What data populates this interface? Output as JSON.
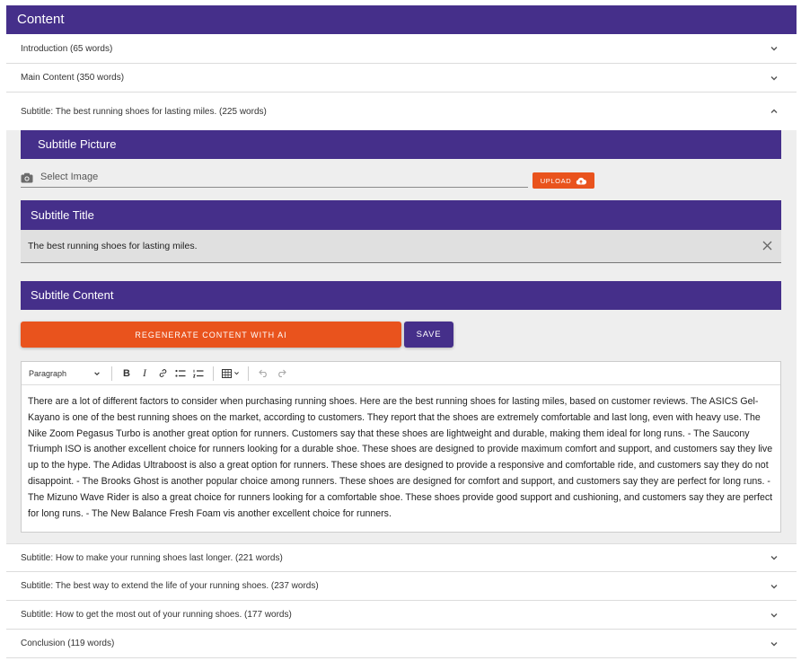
{
  "header": {
    "title": "Content"
  },
  "sections": {
    "introduction": "Introduction  (65 words)",
    "main_content": "Main Content  (350 words)",
    "subtitle_1": "Subtitle: The best running shoes for lasting miles.  (225 words)",
    "subtitle_2": "Subtitle: How to make your running shoes last longer.  (221 words)",
    "subtitle_3": "Subtitle: The best way to extend the life of your running shoes.  (237 words)",
    "subtitle_4": "Subtitle: How to get the most out of your running shoes.  (177 words)",
    "conclusion": "Conclusion  (119 words)"
  },
  "subtitle_picture": {
    "heading": "Subtitle Picture",
    "select_label": "Select Image",
    "upload_label": "UPLOAD"
  },
  "subtitle_title": {
    "heading": "Subtitle Title",
    "value": "The best running shoes for lasting miles."
  },
  "subtitle_content": {
    "heading": "Subtitle Content",
    "regenerate_label": "REGENERATE CONTENT WITH AI",
    "save_label": "SAVE"
  },
  "editor": {
    "format_select": "Paragraph",
    "body": "There are a lot of different factors to consider when purchasing running shoes. Here are the best running shoes for lasting miles, based on customer reviews. The ASICS Gel-Kayano is one of the best running shoes on the market, according to customers. They report that the shoes are extremely comfortable and last long, even with heavy use. The Nike Zoom Pegasus Turbo is another great option for runners. Customers say that these shoes are lightweight and durable, making them ideal for long runs. - The Saucony Triumph ISO is another excellent choice for runners looking for a durable shoe. These shoes are designed to provide maximum comfort and support, and customers say they live up to the hype. The Adidas Ultraboost is also a great option for runners. These shoes are designed to provide a responsive and comfortable ride, and customers say they do not disappoint. - The Brooks Ghost is another popular choice among runners. These shoes are designed for comfort and support, and customers say they are perfect for long runs. - The Mizuno Wave Rider is also a great choice for runners looking for a comfortable shoe. These shoes provide good support and cushioning, and customers say they are perfect for long runs. - The New Balance Fresh Foam vis another excellent choice for runners."
  },
  "icons": {
    "chevron_down": "chevron-down-icon",
    "chevron_up": "chevron-up-icon",
    "camera": "camera-icon",
    "cloud_upload": "cloud-upload-icon",
    "close": "close-icon"
  },
  "colors": {
    "primary": "#452f8a",
    "accent": "#e9531d",
    "panel_bg": "#eeeeee",
    "field_bg": "#e0e0e0"
  }
}
